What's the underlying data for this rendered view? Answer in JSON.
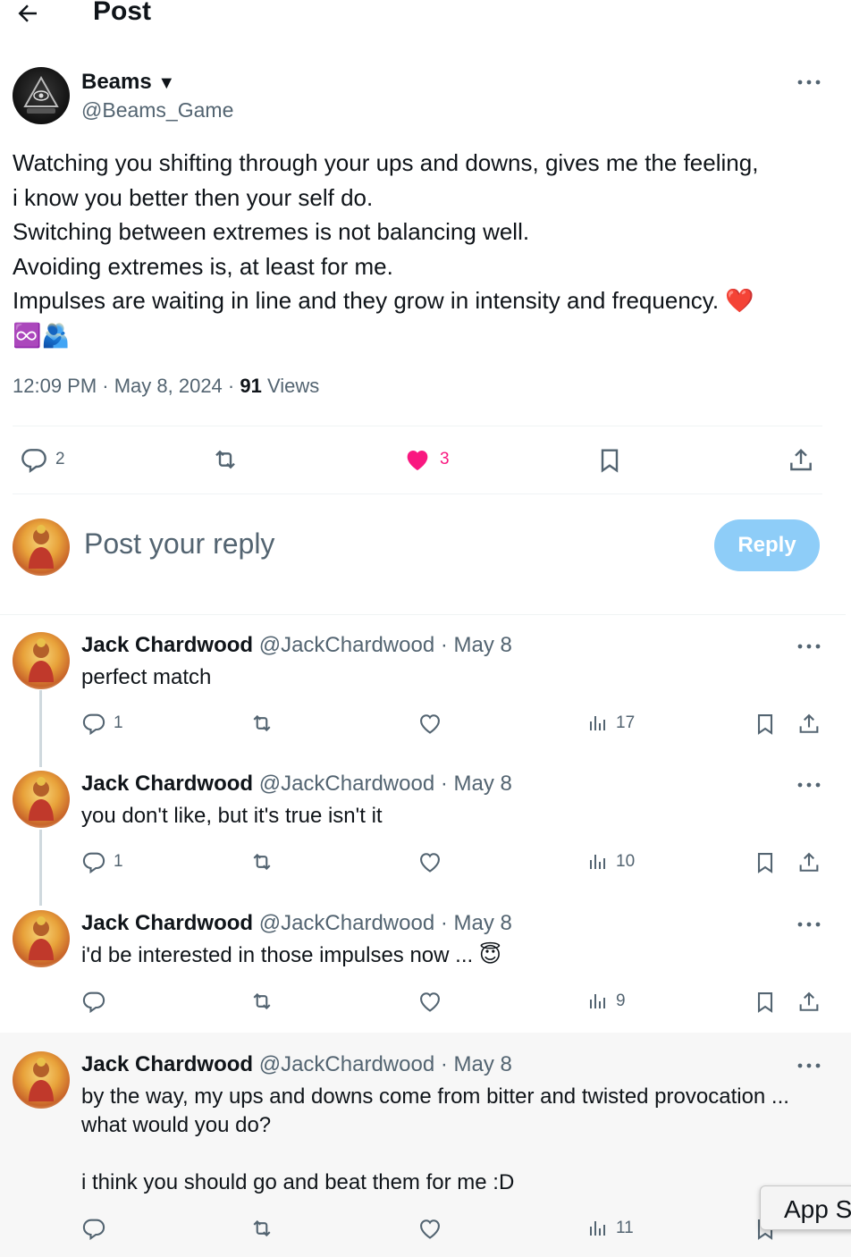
{
  "header": {
    "title": "Post"
  },
  "post": {
    "author_name": "Beams",
    "author_badge": "▼",
    "author_handle": "@Beams_Game",
    "text_lines": [
      "Watching you shifting through your ups and downs, gives me the feeling,",
      "i know you better then your self do.",
      "Switching between extremes is not balancing well.",
      "Avoiding extremes is, at least for me.",
      "Impulses are waiting in line and they grow in intensity and frequency."
    ],
    "line5_emoji": "❤️",
    "emoji_line": "♾️🫂",
    "time": "12:09 PM · May 8, 2024 · ",
    "views_count": "91",
    "views_label": " Views",
    "replies": "2",
    "likes": "3"
  },
  "composer": {
    "placeholder": "Post your reply",
    "button": "Reply"
  },
  "replies": [
    {
      "name": "Jack Chardwood",
      "handle": "@JackChardwood · May 8",
      "text": "perfect match",
      "replies": "1",
      "views": "17"
    },
    {
      "name": "Jack Chardwood",
      "handle": "@JackChardwood · May 8",
      "text": "you don't like, but it's true isn't it",
      "replies": "1",
      "views": "10"
    },
    {
      "name": "Jack Chardwood",
      "handle": "@JackChardwood · May 8",
      "text": "i'd be interested in those impulses now ... 😇",
      "replies": "",
      "views": "9"
    },
    {
      "name": "Jack Chardwood",
      "handle": "@JackChardwood · May 8",
      "text_lines": [
        "by the way, my ups and downs come from bitter and twisted provocation ...",
        "what would you do?",
        "",
        "i think you should go and beat them for me :D"
      ],
      "replies": "",
      "views": "11"
    }
  ],
  "tooltip": {
    "text": "App S"
  },
  "colors": {
    "like": "#f91880",
    "reply_button": "#8ecdf8",
    "muted": "#536471"
  }
}
